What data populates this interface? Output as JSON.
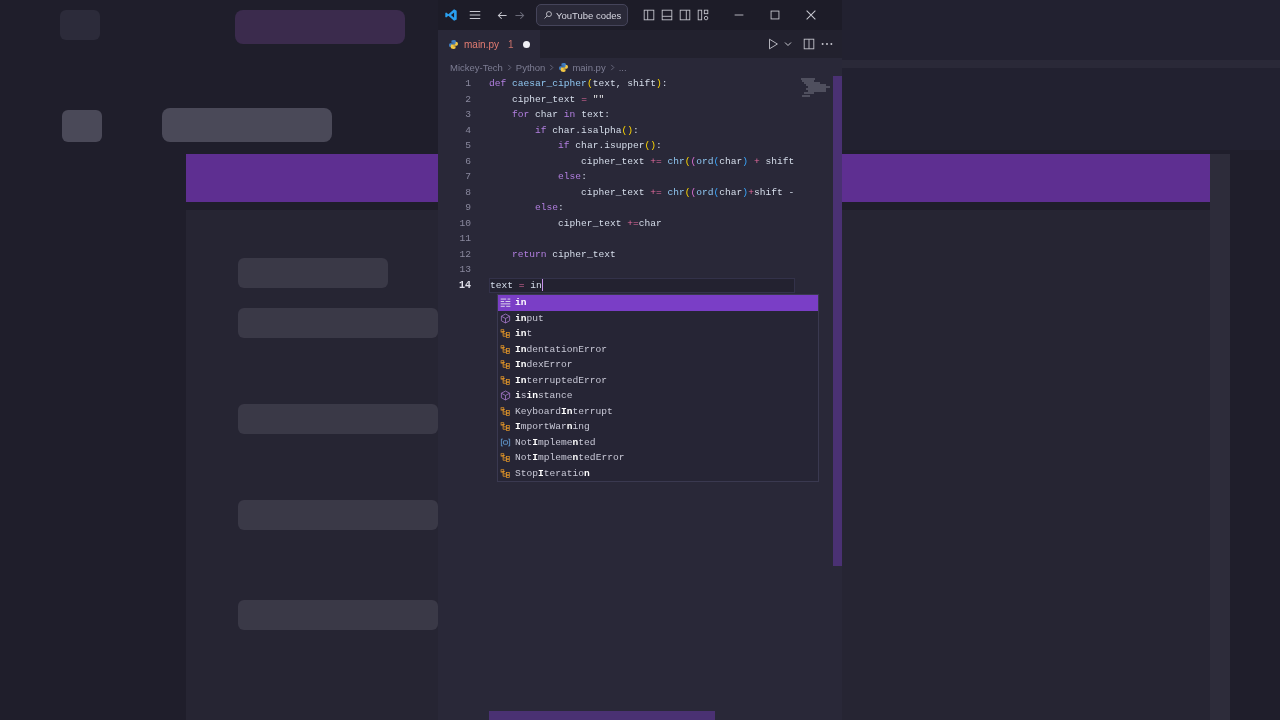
{
  "titlebar": {
    "search": "YouTube codes"
  },
  "tab": {
    "filename": "main.py",
    "problems": "1",
    "modified": true
  },
  "breadcrumbs": [
    "Mickey-Tech",
    "Python",
    "main.py",
    "..."
  ],
  "editor": {
    "lines": [
      {
        "number": "1",
        "current": false,
        "tokens": [
          {
            "kind": "keyword",
            "text": "def "
          },
          {
            "kind": "function",
            "text": "caesar_cipher"
          },
          {
            "kind": "paren1",
            "text": "("
          },
          {
            "kind": "name",
            "text": "text, shift"
          },
          {
            "kind": "paren1",
            "text": ")"
          },
          {
            "kind": "name",
            "text": ":"
          }
        ]
      },
      {
        "number": "2",
        "current": false,
        "tokens": [
          {
            "kind": "name",
            "text": "    cipher_text "
          },
          {
            "kind": "operator",
            "text": "="
          },
          {
            "kind": "string",
            "text": " \"\""
          }
        ]
      },
      {
        "number": "3",
        "current": false,
        "tokens": [
          {
            "kind": "keyword",
            "text": "    for"
          },
          {
            "kind": "name",
            "text": " char "
          },
          {
            "kind": "keyword",
            "text": "in"
          },
          {
            "kind": "name",
            "text": " text:"
          }
        ]
      },
      {
        "number": "4",
        "current": false,
        "tokens": [
          {
            "kind": "keyword",
            "text": "        if"
          },
          {
            "kind": "name",
            "text": " char.isalpha"
          },
          {
            "kind": "paren1",
            "text": "()"
          },
          {
            "kind": "name",
            "text": ":"
          }
        ]
      },
      {
        "number": "5",
        "current": false,
        "tokens": [
          {
            "kind": "keyword",
            "text": "            if"
          },
          {
            "kind": "name",
            "text": " char.isupper"
          },
          {
            "kind": "paren1",
            "text": "()"
          },
          {
            "kind": "name",
            "text": ":"
          }
        ]
      },
      {
        "number": "6",
        "current": false,
        "tokens": [
          {
            "kind": "name",
            "text": "                cipher_text "
          },
          {
            "kind": "operator",
            "text": "+="
          },
          {
            "kind": "function",
            "text": " chr"
          },
          {
            "kind": "paren1",
            "text": "("
          },
          {
            "kind": "paren2",
            "text": "("
          },
          {
            "kind": "function",
            "text": "ord"
          },
          {
            "kind": "paren3",
            "text": "("
          },
          {
            "kind": "name",
            "text": "char"
          },
          {
            "kind": "paren3",
            "text": ")"
          },
          {
            "kind": "operator",
            "text": " +"
          },
          {
            "kind": "name",
            "text": " shift"
          }
        ]
      },
      {
        "number": "7",
        "current": false,
        "tokens": [
          {
            "kind": "keyword",
            "text": "            else"
          },
          {
            "kind": "name",
            "text": ":"
          }
        ]
      },
      {
        "number": "8",
        "current": false,
        "tokens": [
          {
            "kind": "name",
            "text": "                cipher_text "
          },
          {
            "kind": "operator",
            "text": "+="
          },
          {
            "kind": "function",
            "text": " chr"
          },
          {
            "kind": "paren1",
            "text": "("
          },
          {
            "kind": "paren2",
            "text": "("
          },
          {
            "kind": "function",
            "text": "ord"
          },
          {
            "kind": "paren3",
            "text": "("
          },
          {
            "kind": "name",
            "text": "char"
          },
          {
            "kind": "paren3",
            "text": ")"
          },
          {
            "kind": "operator",
            "text": "+"
          },
          {
            "kind": "name",
            "text": "shift -"
          }
        ]
      },
      {
        "number": "9",
        "current": false,
        "tokens": [
          {
            "kind": "keyword",
            "text": "        else"
          },
          {
            "kind": "name",
            "text": ":"
          }
        ]
      },
      {
        "number": "10",
        "current": false,
        "tokens": [
          {
            "kind": "name",
            "text": "            cipher_text "
          },
          {
            "kind": "operator",
            "text": "+="
          },
          {
            "kind": "name",
            "text": "char"
          }
        ]
      },
      {
        "number": "11",
        "current": false
      },
      {
        "number": "12",
        "current": false,
        "tokens": [
          {
            "kind": "keyword",
            "text": "    return"
          },
          {
            "kind": "name",
            "text": " cipher_text"
          }
        ]
      },
      {
        "number": "13",
        "current": false
      },
      {
        "number": "14",
        "current": true,
        "tokens": [
          {
            "kind": "name",
            "text": "text "
          },
          {
            "kind": "operator",
            "text": "="
          },
          {
            "kind": "name",
            "text": " in"
          }
        ]
      }
    ]
  },
  "suggestions": [
    {
      "label": "**in**",
      "kind": "keyword",
      "selected": true
    },
    {
      "label": "**in**put",
      "kind": "function",
      "selected": false
    },
    {
      "label": "**in**t",
      "kind": "class",
      "selected": false
    },
    {
      "label": "**In**dentationError",
      "kind": "class",
      "selected": false
    },
    {
      "label": "**In**dexError",
      "kind": "class",
      "selected": false
    },
    {
      "label": "**In**terruptedError",
      "kind": "class",
      "selected": false
    },
    {
      "label": "**i**s**in**stance",
      "kind": "function",
      "selected": false
    },
    {
      "label": "Keyboard**In**terrupt",
      "kind": "class",
      "selected": false
    },
    {
      "label": "**I**mportWar**n**ing",
      "kind": "class",
      "selected": false
    },
    {
      "label": "Not**I**mpleme**n**ted",
      "kind": "constant",
      "selected": false
    },
    {
      "label": "Not**I**mpleme**n**tedError",
      "kind": "class",
      "selected": false
    },
    {
      "label": "Stop**I**teratio**n**",
      "kind": "class",
      "selected": false
    }
  ]
}
